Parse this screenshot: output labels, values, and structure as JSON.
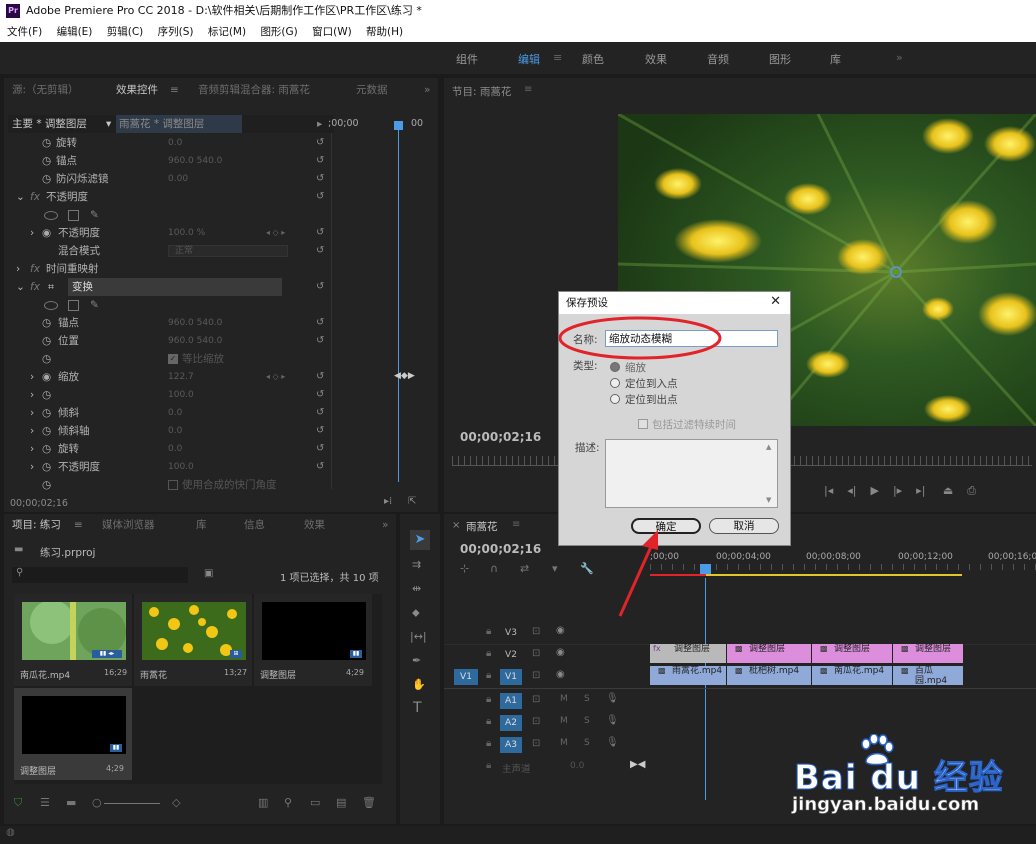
{
  "window": {
    "app_icon": "Pr",
    "title": "Adobe Premiere Pro CC 2018 - D:\\软件相关\\后期制作工作区\\PR工作区\\练习 *"
  },
  "menu": [
    "文件(F)",
    "编辑(E)",
    "剪辑(C)",
    "序列(S)",
    "标记(M)",
    "图形(G)",
    "窗口(W)",
    "帮助(H)"
  ],
  "workspaces": [
    "组件",
    "编辑",
    "颜色",
    "效果",
    "音频",
    "图形",
    "库"
  ],
  "effect_panel": {
    "tabs": [
      "源:（无剪辑）",
      "效果控件",
      "音频剪辑混合器: 雨蒿花",
      "元数据"
    ],
    "clip_path_main": "主要 * 调整图层",
    "clip_path_target": "雨蒿花 * 调整图层",
    "timecode_start": ";00;00",
    "timecode_end": "00",
    "rows": [
      {
        "label": "旋转",
        "value": "0.0"
      },
      {
        "label": "锚点",
        "value": "960.0    540.0"
      },
      {
        "label": "防闪烁滤镜",
        "value": "0.00"
      },
      {
        "label": "不透明度",
        "value": ""
      },
      {
        "label": "不透明度",
        "value": "100.0 %"
      },
      {
        "label": "混合模式",
        "value": "正常"
      },
      {
        "label": "时间重映射",
        "value": ""
      },
      {
        "label": "变换",
        "value": ""
      },
      {
        "label": "锚点",
        "value": "960.0    540.0"
      },
      {
        "label": "位置",
        "value": "960.0    540.0"
      },
      {
        "label": "等比缩放",
        "value": ""
      },
      {
        "label": "缩放",
        "value": "122.7"
      },
      {
        "label": "",
        "value": "100.0"
      },
      {
        "label": "倾斜",
        "value": "0.0"
      },
      {
        "label": "倾斜轴",
        "value": "0.0"
      },
      {
        "label": "旋转",
        "value": "0.0"
      },
      {
        "label": "不透明度",
        "value": "100.0"
      },
      {
        "label": "使用合成的快门角度",
        "value": ""
      }
    ],
    "fx_label": "fx",
    "current_time": "00;00;02;16"
  },
  "program_monitor": {
    "title": "节目: 雨蒿花",
    "timecode": "00;00;02;16"
  },
  "project_panel": {
    "tabs": [
      "项目: 练习",
      "媒体浏览器",
      "库",
      "信息",
      "效果"
    ],
    "filename": "练习.prproj",
    "selection_status": "1 项已选择，共 10 项",
    "items": [
      {
        "name": "南瓜花.mp4",
        "duration": "16;29"
      },
      {
        "name": "雨蒿花",
        "duration": "13;27"
      },
      {
        "name": "调整图层",
        "duration": "4;29"
      },
      {
        "name": "调整图层",
        "duration": "4;29"
      }
    ]
  },
  "timeline": {
    "tab": "雨蒿花",
    "timecode": "00;00;02;16",
    "ruler": [
      ";00;00",
      "00;00;04;00",
      "00;00;08;00",
      "00;00;12;00",
      "00;00;16;00"
    ],
    "tracks": [
      "V3",
      "V2",
      "V1",
      "A1",
      "A2",
      "A3"
    ],
    "source_patch": "V1",
    "track_tools": [
      "M",
      "S"
    ],
    "master": {
      "label": "主声道",
      "value": "0.0"
    },
    "v2_clips": [
      "调整图层",
      "调整图层",
      "调整图层",
      "调整图层"
    ],
    "v1_clips": [
      "雨蒿花.mp4",
      "枇杷树.mp4",
      "南瓜花.mp4",
      "百瓜园.mp4"
    ]
  },
  "dialog": {
    "title": "保存预设",
    "name_label": "名称:",
    "name_value": "缩放动态模糊",
    "type_label": "类型:",
    "type_options": [
      "缩放",
      "定位到入点",
      "定位到出点"
    ],
    "checkbox_label": "包括过滤特续时间",
    "desc_label": "描述:",
    "ok_label": "确定",
    "cancel_label": "取消"
  },
  "watermark": {
    "brand": "Bai du 经验",
    "url": "jingyan.baidu.com"
  },
  "colors": {
    "accent": "#4b9be6",
    "annotation": "#e0242a",
    "clip_video": "#8fa9d8",
    "clip_adjust": "#dc8edc"
  }
}
